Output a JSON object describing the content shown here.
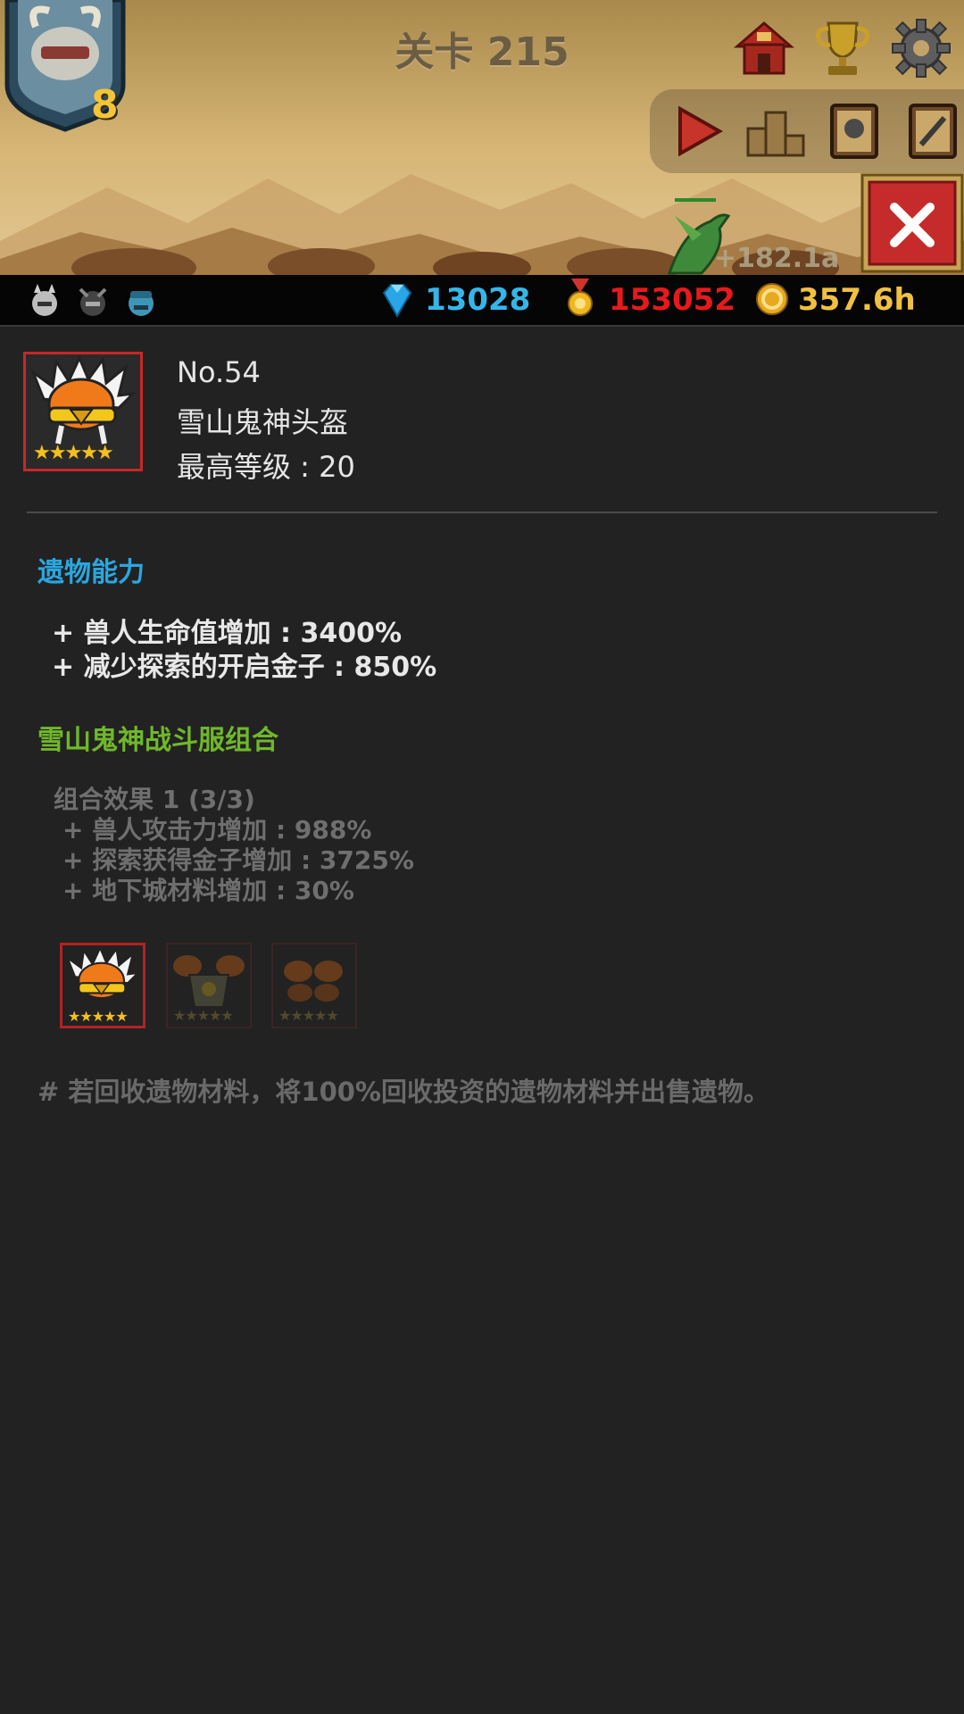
{
  "header": {
    "stage_title": "关卡 215",
    "hero_level": "8",
    "damage_text": "+182.1a",
    "top_icons": [
      "shop-house-icon",
      "trophy-icon",
      "gear-icon"
    ],
    "toolbar_icons": [
      "play-icon",
      "podium-icon",
      "ghost-book-icon",
      "sword-book-icon"
    ]
  },
  "resources": {
    "party_icons": [
      "white-orc-icon",
      "dark-orc-icon",
      "blue-orc-icon"
    ],
    "gems": "13028",
    "medals": "153052",
    "gold": "357.6h",
    "colors": {
      "gems": "#35b6ea",
      "medals": "#e8191c",
      "gold": "#f0c040"
    }
  },
  "relic": {
    "number": "No.54",
    "name": "雪山鬼神头盔",
    "max_level": "最高等级 : 20",
    "stars": 5
  },
  "abilities": {
    "title": "遗物能力",
    "lines": [
      "+ 兽人生命值增加 : 3400%",
      "+ 减少探索的开启金子 : 850%"
    ]
  },
  "set": {
    "title": "雪山鬼神战斗服组合",
    "effect_title": "组合效果 1 (3/3)",
    "lines": [
      "+ 兽人攻击力增加 : 988%",
      "+ 探索获得金子增加 : 3725%",
      "+ 地下城材料增加 : 30%"
    ]
  },
  "footnote": "# 若回收遗物材料，将100%回收投资的遗物材料并出售遗物。",
  "colors": {
    "accent_blue": "#2aa7e0",
    "accent_green": "#6fb82a",
    "frame_red": "#c62828",
    "panel_bg": "#222222"
  }
}
